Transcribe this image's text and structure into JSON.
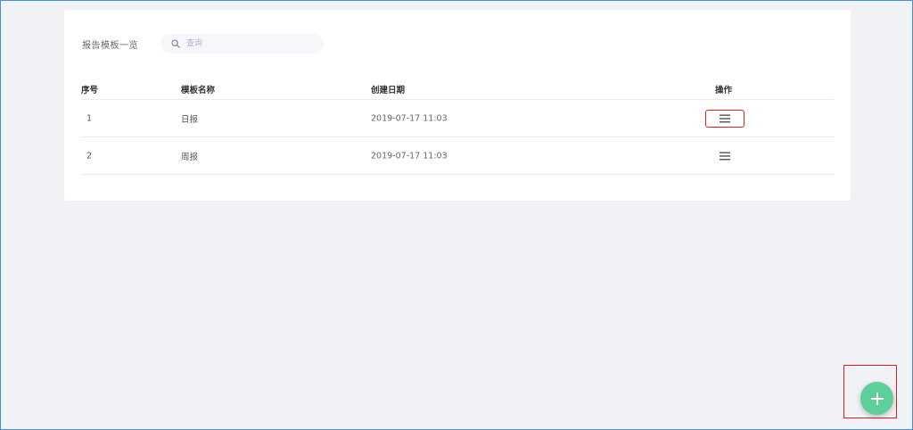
{
  "toolbar": {
    "title": "报告模板一览",
    "search_placeholder": "查询",
    "search_value": ""
  },
  "table": {
    "columns": [
      "序号",
      "模板名称",
      "创建日期",
      "操作"
    ],
    "rows": [
      {
        "index": "1",
        "name": "日报",
        "created": "2019-07-17 11:03",
        "action_icon": "menu-icon"
      },
      {
        "index": "2",
        "name": "周报",
        "created": "2019-07-17 11:03",
        "action_icon": "menu-icon"
      }
    ]
  },
  "fab": {
    "icon": "plus-icon",
    "color": "#5dcf9a"
  },
  "colors": {
    "highlight": "#e02020",
    "background": "#f0f2f5",
    "card": "#ffffff"
  }
}
